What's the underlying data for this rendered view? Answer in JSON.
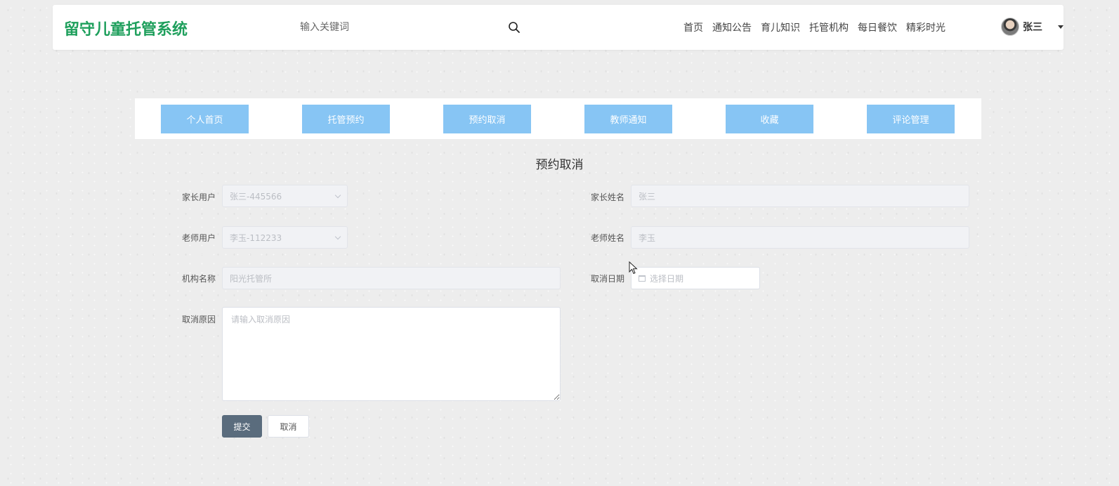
{
  "header": {
    "logo": "留守儿童托管系统",
    "search_placeholder": "输入关键词",
    "nav": [
      "首页",
      "通知公告",
      "育儿知识",
      "托管机构",
      "每日餐饮",
      "精彩时光"
    ],
    "user_name": "张三"
  },
  "tabs": [
    "个人首页",
    "托管预约",
    "预约取消",
    "教师通知",
    "收藏",
    "评论管理"
  ],
  "form": {
    "title": "预约取消",
    "parent_user_label": "家长用户",
    "parent_user_value": "张三-445566",
    "parent_name_label": "家长姓名",
    "parent_name_value": "张三",
    "teacher_user_label": "老师用户",
    "teacher_user_value": "李玉-112233",
    "teacher_name_label": "老师姓名",
    "teacher_name_value": "李玉",
    "org_label": "机构名称",
    "org_value": "阳光托管所",
    "cancel_date_label": "取消日期",
    "cancel_date_placeholder": "选择日期",
    "reason_label": "取消原因",
    "reason_placeholder": "请输入取消原因",
    "submit_label": "提交",
    "cancel_label": "取消"
  },
  "colors": {
    "logo": "#1e9f5c",
    "tab_bg": "#87c5f4",
    "submit_bg": "#5a6c7d"
  }
}
